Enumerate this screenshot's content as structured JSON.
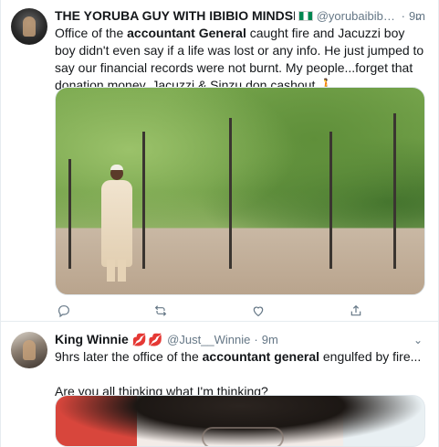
{
  "tweets": [
    {
      "display_name": "THE YORUBA GUY WITH IBIBIO MINDSET",
      "handle": "@yorubaibibio...",
      "separator": "·",
      "time": "9m",
      "text": {
        "part1": "Office of the ",
        "bold1": "accountant General",
        "part2": " caught fire and Jacuzzi boy boy didn't even say if a life was lost or any info. He just jumped to say our financial records were not burnt. My people...forget that donation money. Jacuzzi & Sinzu don cashout ",
        "emoji": "🚶"
      },
      "has_media": true
    },
    {
      "display_name": "King Winnie",
      "emoji_after_name": "💋💋",
      "handle": "@Just__Winnie",
      "separator": "·",
      "time": "9m",
      "text": {
        "part1": "9hrs later the office of the ",
        "bold1": "accountant general",
        "part2": " engulfed by fire...",
        "line2": "Are you all thinking what I'm thinking?"
      },
      "has_media": true
    }
  ],
  "colors": {
    "muted": "#657786",
    "border": "#e6ecf0",
    "text": "#14171a",
    "like": "#e0245e"
  },
  "icons": [
    "reply-icon",
    "retweet-icon",
    "like-icon",
    "share-icon",
    "caret-down-icon"
  ]
}
